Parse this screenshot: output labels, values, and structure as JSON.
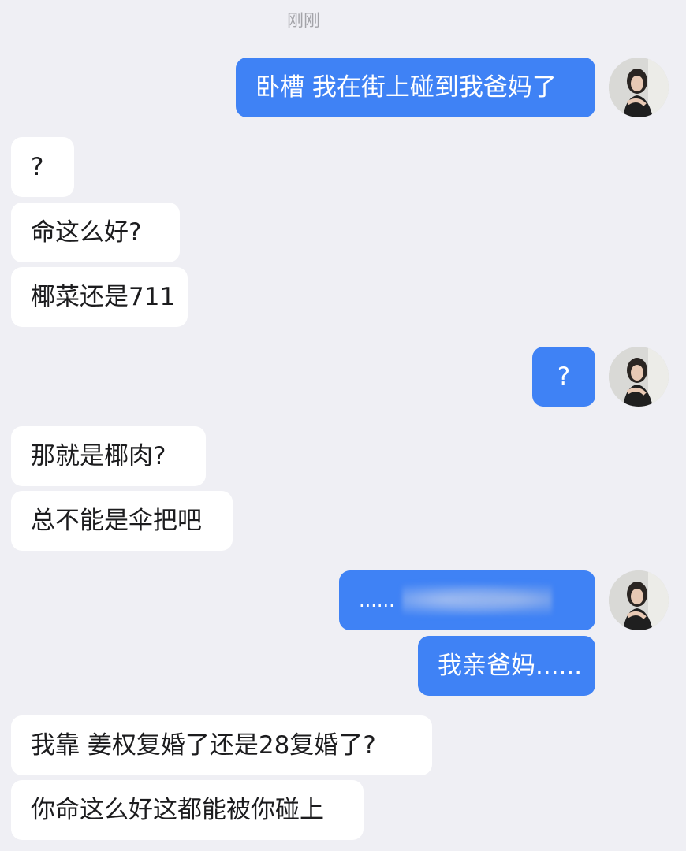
{
  "header": {
    "timestamp": "刚刚"
  },
  "messages": [
    {
      "sender": "me",
      "text": "卧槽 我在街上碰到我爸妈了"
    },
    {
      "sender": "friend",
      "text": "?"
    },
    {
      "sender": "friend",
      "text": "命这么好?"
    },
    {
      "sender": "friend",
      "text": "椰菜还是711"
    },
    {
      "sender": "me",
      "text": "?"
    },
    {
      "sender": "friend",
      "text": "那就是椰肉?"
    },
    {
      "sender": "friend",
      "text": "总不能是伞把吧"
    },
    {
      "sender": "me",
      "text": "......"
    },
    {
      "sender": "me",
      "text": "我亲爸妈......"
    },
    {
      "sender": "friend",
      "text": "我靠 姜权复婚了还是28复婚了?"
    },
    {
      "sender": "friend",
      "text": "你命这么好这都能被你碰上"
    }
  ],
  "colors": {
    "background": "#efeff4",
    "outgoing_bubble": "#3f82f5",
    "incoming_bubble": "#ffffff",
    "timestamp_text": "#a3a3a8"
  },
  "icons": {
    "user_avatar": "avatar-icon"
  }
}
